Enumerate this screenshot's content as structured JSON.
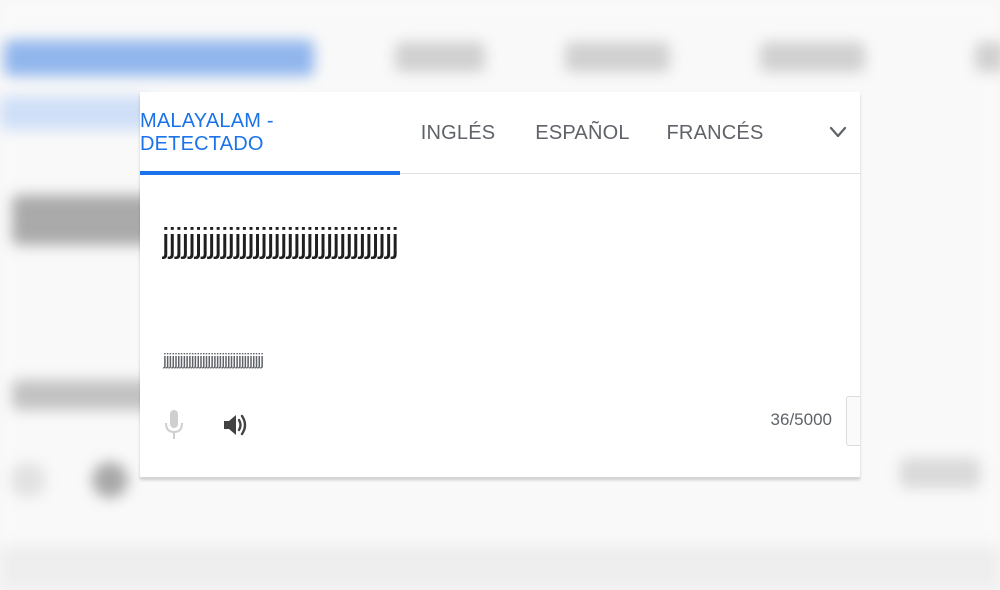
{
  "language_tabs": [
    {
      "label": "MALAYALAM - DETECTADO",
      "active": true
    },
    {
      "label": "INGLÉS",
      "active": false
    },
    {
      "label": "ESPAÑOL",
      "active": false
    },
    {
      "label": "FRANCÉS",
      "active": false
    }
  ],
  "more_languages_icon": "chevron-down-icon",
  "source": {
    "text": "jjjjjjjjjjjjjjjjjjjjjjjjjjjjjjjjjjjj",
    "transliteration": "jjjjjjjjjjjjjjjjjjjjjjjjjjjjjjjjjjjj"
  },
  "footer": {
    "mic_icon": "microphone-icon",
    "speaker_icon": "speaker-icon",
    "char_count": "36/5000"
  },
  "colors": {
    "accent": "#1a73e8",
    "inactive_tab_text": "#5f6368",
    "mic_disabled": "#bdbdbd",
    "speaker": "#424242"
  }
}
